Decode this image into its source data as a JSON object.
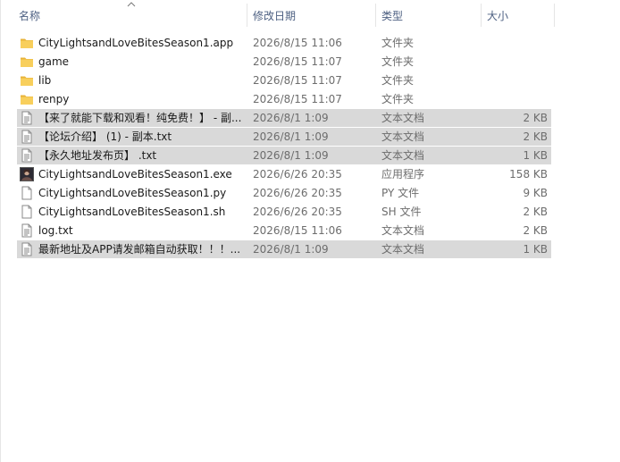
{
  "columns": {
    "name": "名称",
    "date": "修改日期",
    "type": "类型",
    "size": "大小"
  },
  "files": [
    {
      "name": "CityLightsandLoveBitesSeason1.app",
      "date": "2026/8/15 11:06",
      "type": "文件夹",
      "size": "",
      "icon": "folder-icon",
      "highlighted": false
    },
    {
      "name": "game",
      "date": "2026/8/15 11:07",
      "type": "文件夹",
      "size": "",
      "icon": "folder-icon",
      "highlighted": false
    },
    {
      "name": "lib",
      "date": "2026/8/15 11:07",
      "type": "文件夹",
      "size": "",
      "icon": "folder-icon",
      "highlighted": false
    },
    {
      "name": "renpy",
      "date": "2026/8/15 11:07",
      "type": "文件夹",
      "size": "",
      "icon": "folder-icon",
      "highlighted": false
    },
    {
      "name": "【来了就能下载和观看！纯免费！】 - 副...",
      "date": "2026/8/1 1:09",
      "type": "文本文档",
      "size": "2 KB",
      "icon": "text-file-icon",
      "highlighted": true
    },
    {
      "name": "【论坛介绍】 (1) - 副本.txt",
      "date": "2026/8/1 1:09",
      "type": "文本文档",
      "size": "2 KB",
      "icon": "text-file-icon",
      "highlighted": true
    },
    {
      "name": "【永久地址发布页】 .txt",
      "date": "2026/8/1 1:09",
      "type": "文本文档",
      "size": "1 KB",
      "icon": "text-file-icon",
      "highlighted": true
    },
    {
      "name": "CityLightsandLoveBitesSeason1.exe",
      "date": "2026/6/26 20:35",
      "type": "应用程序",
      "size": "158 KB",
      "icon": "app-image-icon",
      "highlighted": false
    },
    {
      "name": "CityLightsandLoveBitesSeason1.py",
      "date": "2026/6/26 20:35",
      "type": "PY 文件",
      "size": "9 KB",
      "icon": "blank-file-icon",
      "highlighted": false
    },
    {
      "name": "CityLightsandLoveBitesSeason1.sh",
      "date": "2026/6/26 20:35",
      "type": "SH 文件",
      "size": "2 KB",
      "icon": "blank-file-icon",
      "highlighted": false
    },
    {
      "name": "log.txt",
      "date": "2026/8/15 11:06",
      "type": "文本文档",
      "size": "2 KB",
      "icon": "text-file-icon",
      "highlighted": false
    },
    {
      "name": "最新地址及APP请发邮箱自动获取！！！...",
      "date": "2026/8/1 1:09",
      "type": "文本文档",
      "size": "1 KB",
      "icon": "text-file-icon",
      "highlighted": true
    }
  ],
  "colors": {
    "header_text": "#4d6082",
    "highlight": "#d9d9d9",
    "folder": "#f4c44e"
  }
}
